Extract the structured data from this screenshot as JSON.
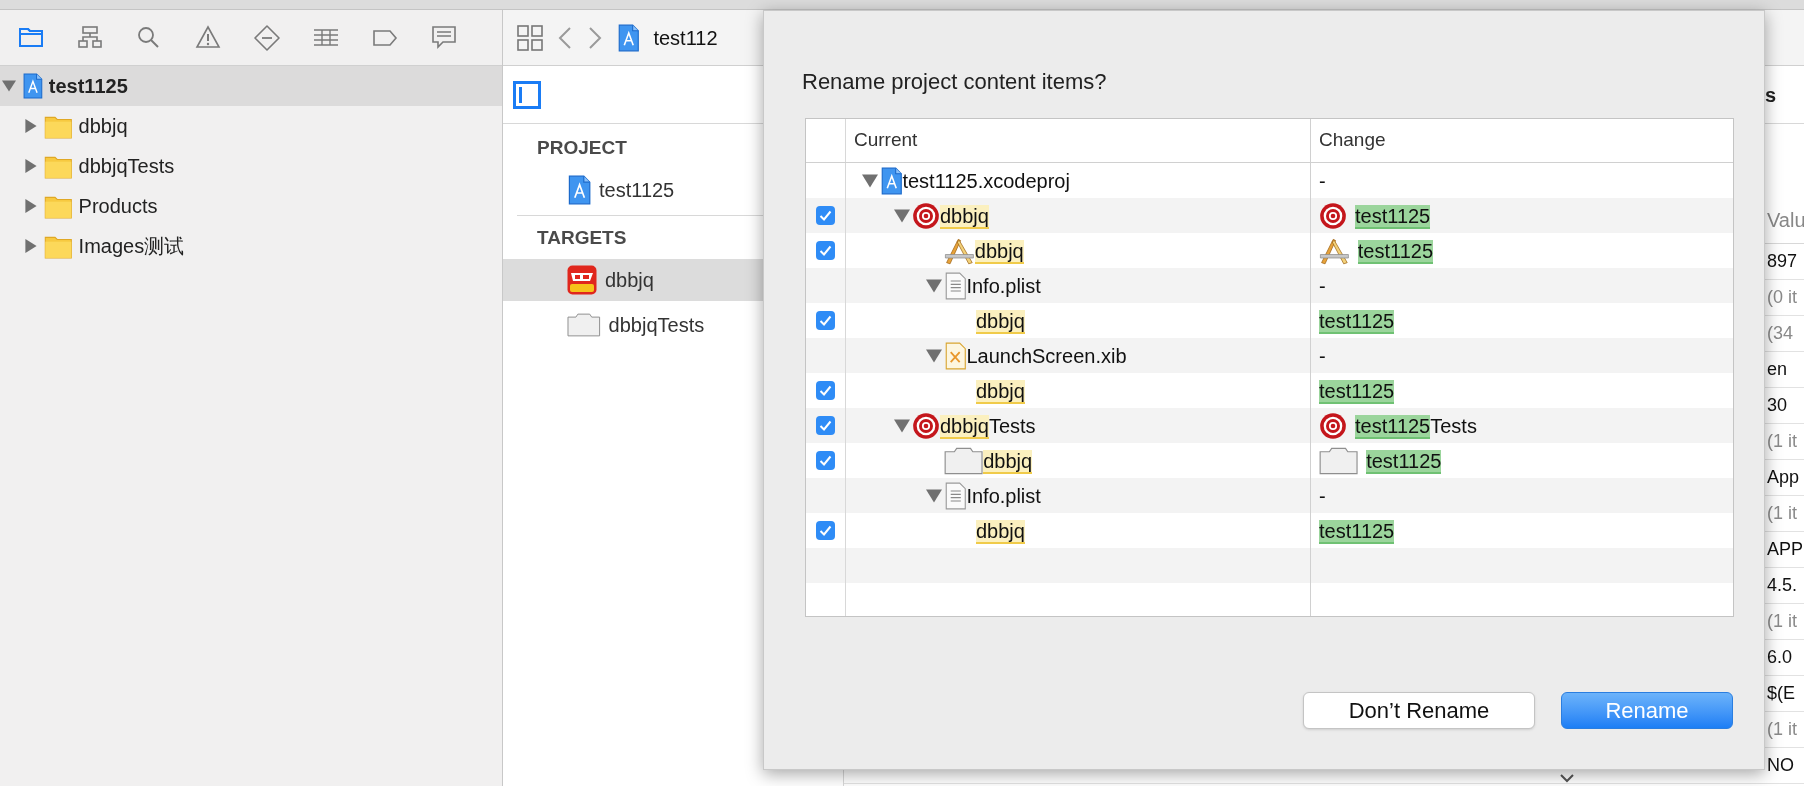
{
  "navigator_tabs": [
    {
      "kind": "folder",
      "selected": true
    },
    {
      "kind": "hierarchy",
      "selected": false
    },
    {
      "kind": "search",
      "selected": false
    },
    {
      "kind": "warning",
      "selected": false
    },
    {
      "kind": "diamond",
      "selected": false
    },
    {
      "kind": "list",
      "selected": false
    },
    {
      "kind": "tag",
      "selected": false
    },
    {
      "kind": "comment",
      "selected": false
    }
  ],
  "project_tree": {
    "name": "test1125",
    "kind": "project",
    "expanded": true,
    "selected": true,
    "children": [
      {
        "name": "dbbjq",
        "kind": "folder",
        "expanded": false,
        "selected": false
      },
      {
        "name": "dbbjqTests",
        "kind": "folder",
        "expanded": false,
        "selected": false
      },
      {
        "name": "Products",
        "kind": "folder",
        "expanded": false,
        "selected": false
      },
      {
        "name": "Images测试",
        "kind": "folder",
        "expanded": false,
        "selected": false
      }
    ]
  },
  "jump_bar": {
    "title": "test112"
  },
  "project_list": [
    {
      "header": "PROJECT",
      "items": [
        {
          "name": "test1125",
          "kind": "project",
          "selected": false
        }
      ]
    },
    {
      "header": "TARGETS",
      "items": [
        {
          "name": "dbbjq",
          "kind": "app",
          "selected": true
        },
        {
          "name": "dbbjqTests",
          "kind": "bundle",
          "selected": false
        }
      ]
    }
  ],
  "inspector": {
    "header": "s",
    "column": "Valu",
    "values": [
      {
        "text": "897",
        "dimmed": false
      },
      {
        "text": "(0 it",
        "dimmed": true
      },
      {
        "text": "(34",
        "dimmed": true
      },
      {
        "text": "en",
        "dimmed": false
      },
      {
        "text": "30",
        "dimmed": false
      },
      {
        "text": "(1 it",
        "dimmed": true
      },
      {
        "text": "App",
        "dimmed": false
      },
      {
        "text": "(1 it",
        "dimmed": true
      },
      {
        "text": "APP",
        "dimmed": false
      },
      {
        "text": "4.5.",
        "dimmed": false
      },
      {
        "text": "(1 it",
        "dimmed": true
      },
      {
        "text": "6.0",
        "dimmed": false
      },
      {
        "text": "$(E",
        "dimmed": false
      },
      {
        "text": "(1 it",
        "dimmed": true
      },
      {
        "text": "NO",
        "dimmed": false
      }
    ]
  },
  "dialog": {
    "title": "Rename project content items?",
    "columns": [
      "Current",
      "Change"
    ],
    "rows": [
      {
        "name": "test1125.xcodeproj",
        "kind": "project",
        "highlighted": false,
        "change": "-",
        "expanded": true,
        "children": [
          {
            "name": "dbbjq",
            "kind": "target",
            "highlighted": true,
            "change": "test1125",
            "change_highlighted": true,
            "checked": true,
            "expanded": true,
            "children": [
              {
                "name": "dbbjq",
                "kind": "app",
                "highlighted": true,
                "change": "test1125",
                "change_highlighted": true,
                "checked": true
              },
              {
                "name": "Info.plist",
                "kind": "plist",
                "highlighted": false,
                "change": "-",
                "expanded": true,
                "children": [
                  {
                    "name": "dbbjq",
                    "highlighted": true,
                    "change": "test1125",
                    "change_highlighted": true,
                    "checked": true
                  }
                ]
              },
              {
                "name": "LaunchScreen.xib",
                "kind": "xib",
                "highlighted": false,
                "change": "-",
                "expanded": true,
                "children": [
                  {
                    "name": "dbbjq",
                    "highlighted": true,
                    "change": "test1125",
                    "change_highlighted": true,
                    "checked": true
                  }
                ]
              }
            ]
          },
          {
            "name": "dbbjq",
            "name_suffix": "Tests",
            "kind": "target",
            "highlighted": true,
            "change": "test1125",
            "change_suffix": "Tests",
            "change_highlighted": true,
            "checked": true,
            "expanded": true,
            "children": [
              {
                "name": "dbbjq",
                "kind": "bundle",
                "highlighted": true,
                "change": "test1125",
                "change_highlighted": true,
                "checked": true
              },
              {
                "name": "Info.plist",
                "kind": "plist",
                "highlighted": false,
                "change": "-",
                "expanded": true,
                "children": [
                  {
                    "name": "dbbjq",
                    "highlighted": true,
                    "change": "test1125",
                    "change_highlighted": true,
                    "checked": true
                  }
                ]
              }
            ]
          }
        ]
      }
    ],
    "buttons": [
      {
        "label": "Don’t Rename",
        "default": false
      },
      {
        "label": "Rename",
        "default": true
      }
    ]
  }
}
